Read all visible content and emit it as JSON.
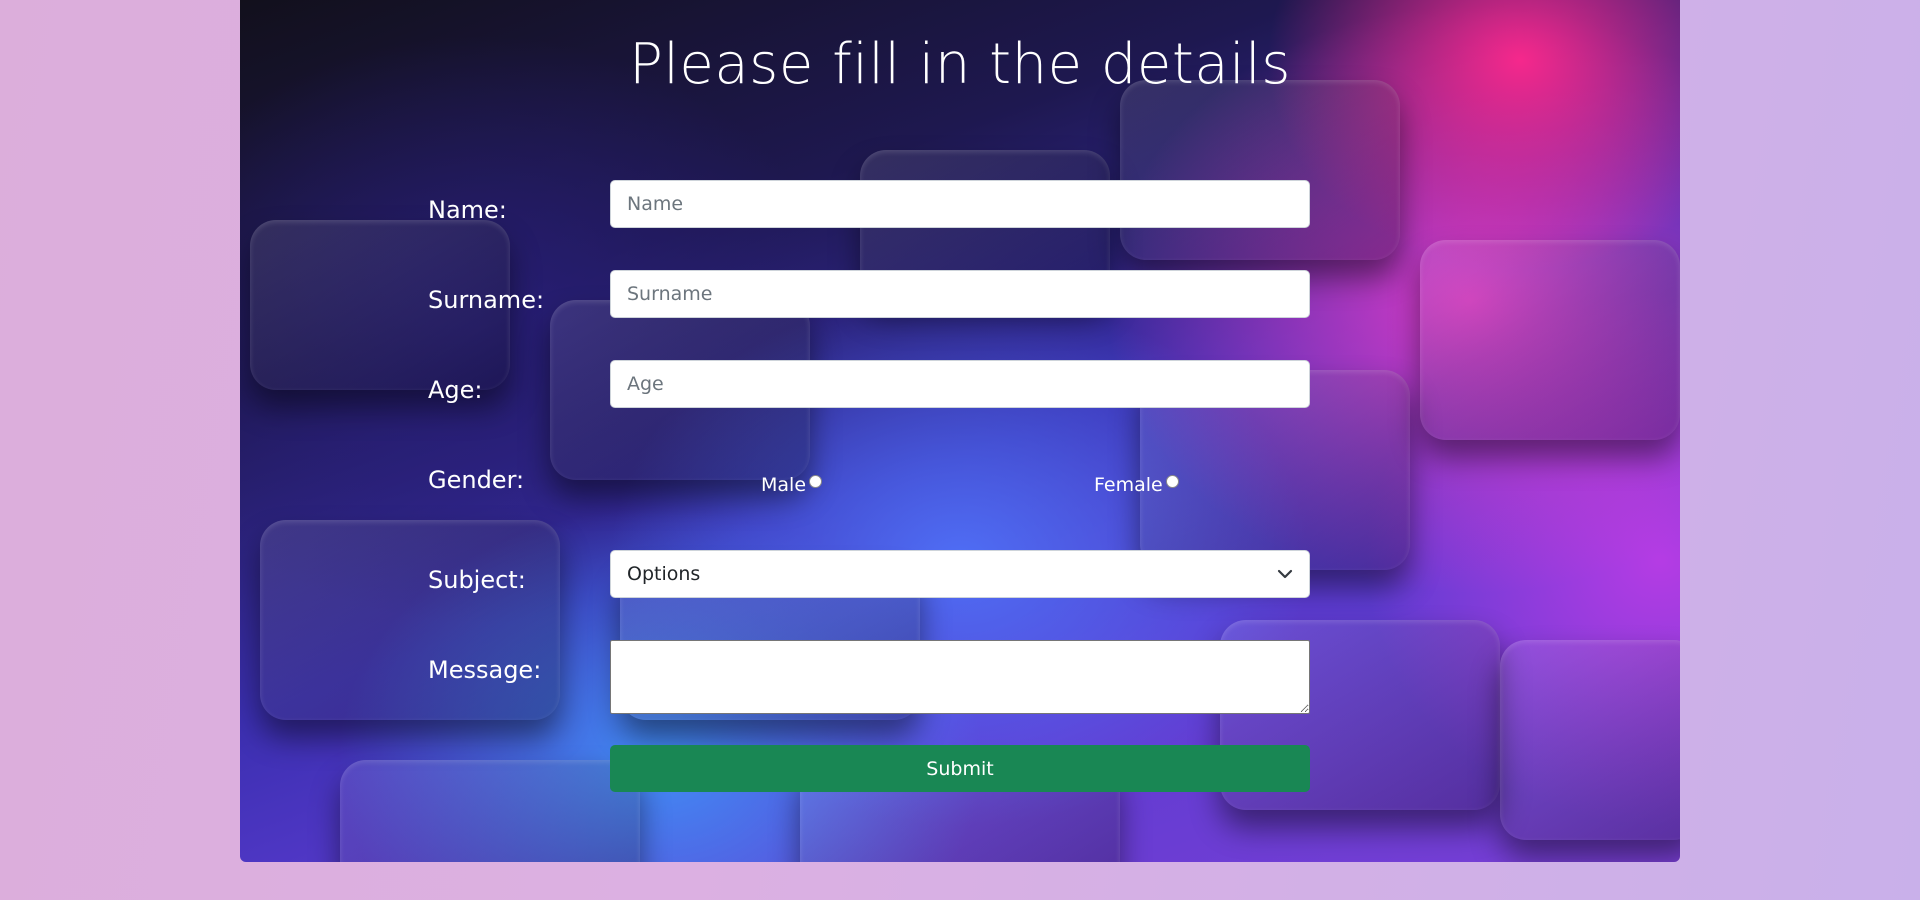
{
  "form": {
    "title": "Please fill in the details",
    "name_label": "Name:",
    "name_placeholder": "Name",
    "surname_label": "Surname:",
    "surname_placeholder": "Surname",
    "age_label": "Age:",
    "age_placeholder": "Age",
    "gender_label": "Gender:",
    "gender_options": [
      "Male",
      "Female"
    ],
    "subject_label": "Subject:",
    "subject_selected": "Options",
    "message_label": "Message:",
    "submit_label": "Submit"
  },
  "colors": {
    "submit_bg": "#198754",
    "page_bg": "#dcaedb",
    "text": "#ffffff"
  }
}
